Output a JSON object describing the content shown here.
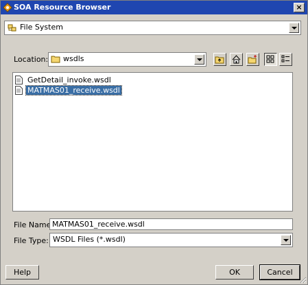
{
  "window": {
    "title": "SOA Resource Browser",
    "close_glyph": "×"
  },
  "source_combo": {
    "value": "File System"
  },
  "location": {
    "label": "Location:",
    "value": "wsdls"
  },
  "toolbar": {
    "icons": [
      "up-folder-icon",
      "home-icon",
      "new-folder-icon",
      "list-view-icon",
      "details-view-icon"
    ]
  },
  "files": [
    {
      "name": "GetDetail_invoke.wsdl",
      "selected": false
    },
    {
      "name": "MATMAS01_receive.wsdl",
      "selected": true
    }
  ],
  "file_name": {
    "label": "File Name:",
    "value": "MATMAS01_receive.wsdl"
  },
  "file_type": {
    "label": "File Type:",
    "value": "WSDL Files (*.wsdl)"
  },
  "buttons": {
    "help": "Help",
    "ok": "OK",
    "cancel": "Cancel"
  },
  "colors": {
    "title_bar": "#1f46b0",
    "selection": "#3a6ea5",
    "dialog_bg": "#d4d0c8"
  }
}
